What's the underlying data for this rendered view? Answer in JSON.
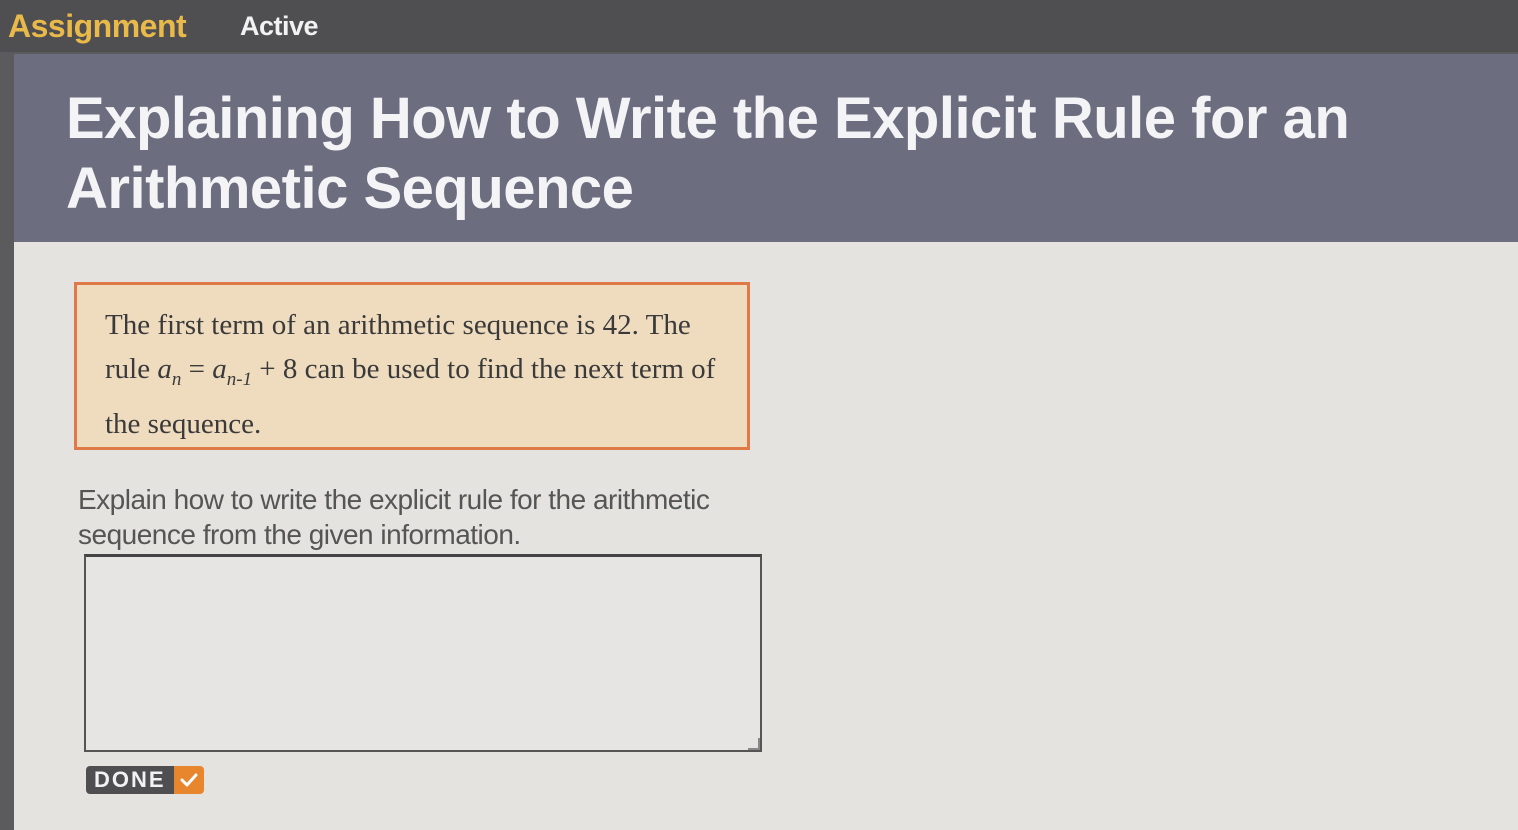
{
  "topbar": {
    "assignment_label": "Assignment",
    "status_label": "Active"
  },
  "header": {
    "title": "Explaining How to Write the Explicit Rule for an Arithmetic Sequence"
  },
  "problem": {
    "line1": "The first term of an arithmetic sequence is",
    "first_term": "42",
    "rule_prefix": ". The rule ",
    "rule_lhs_var": "a",
    "rule_lhs_sub": "n",
    "rule_eq": " = ",
    "rule_rhs_var": "a",
    "rule_rhs_sub": "n-1",
    "rule_plus": " + 8",
    "rule_suffix": " can be used to find the next term of the sequence."
  },
  "prompt": {
    "text": "Explain how to write the explicit rule for the arithmetic sequence from the given information."
  },
  "answer": {
    "value": ""
  },
  "done_button": {
    "label": "DONE",
    "check_icon": "checkmark-icon"
  },
  "colors": {
    "accent_orange": "#e8862e",
    "assignment_gold": "#e9b949",
    "header_bg": "#6d6d80",
    "problem_bg": "#efdcbf",
    "problem_border": "#df7a48"
  }
}
